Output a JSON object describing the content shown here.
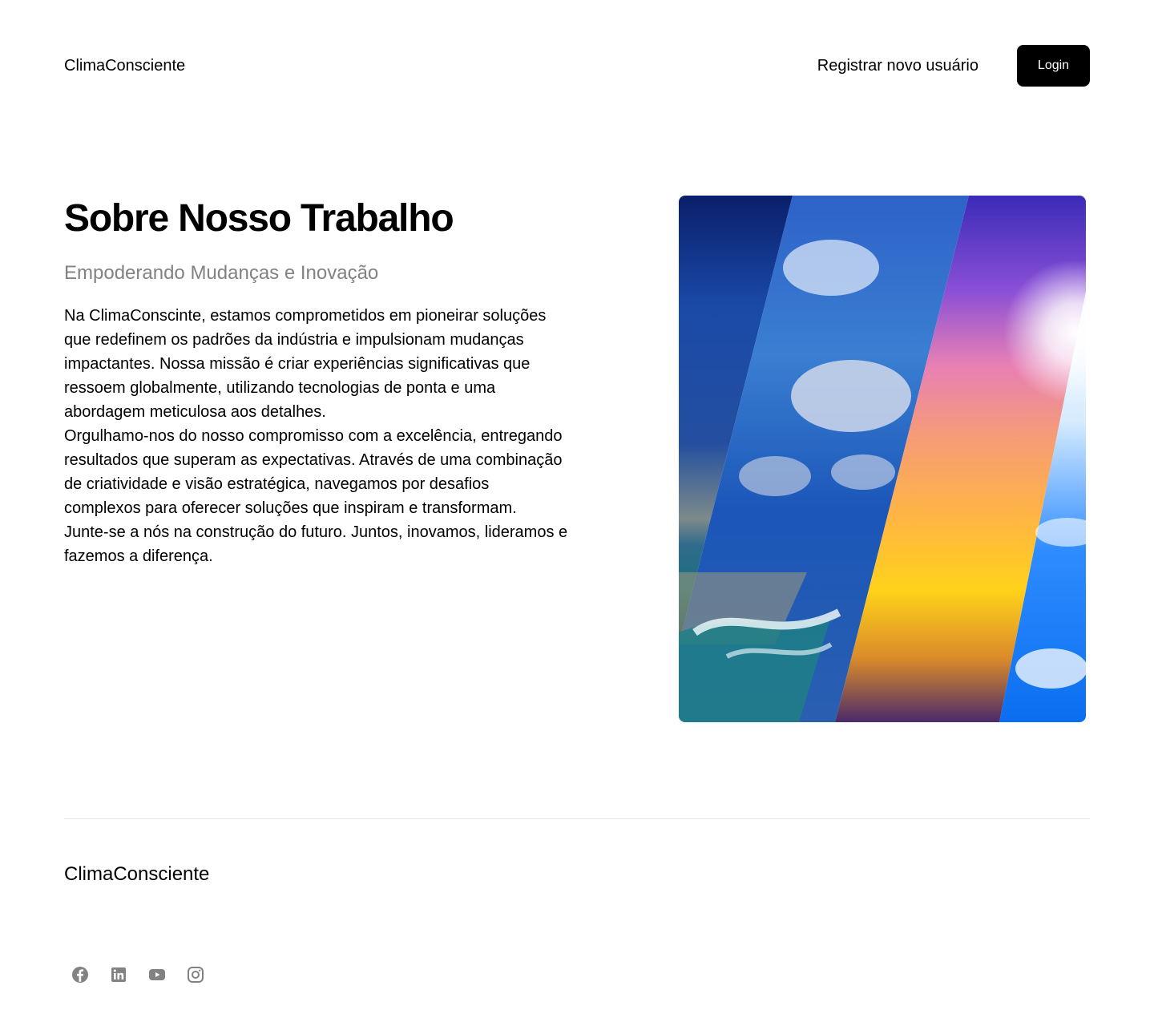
{
  "header": {
    "brand": "ClimaConsciente",
    "register_label": "Registrar novo usuário",
    "login_label": "Login"
  },
  "hero": {
    "title": "Sobre Nosso Trabalho",
    "subtitle": "Empoderando Mudanças e Inovação",
    "paragraphs": [
      "Na ClimaConscinte, estamos comprometidos em pioneirar soluções que redefinem os padrões da indústria e impulsionam mudanças impactantes. Nossa missão é criar experiências significativas que ressoem globalmente, utilizando tecnologias de ponta e uma abordagem meticulosa aos detalhes.",
      "Orgulhamo-nos do nosso compromisso com a excelência, entregando resultados que superam as expectativas. Através de uma combinação de criatividade e visão estratégica, navegamos por desafios complexos para oferecer soluções que inspiram e transformam.",
      "Junte-se a nós na construção do futuro. Juntos, inovamos, lideramos e fazemos a diferença."
    ]
  },
  "footer": {
    "brand": "ClimaConsciente",
    "social_icons": [
      "facebook-icon",
      "linkedin-icon",
      "youtube-icon",
      "instagram-icon"
    ],
    "icon_color": "#828282"
  },
  "colors": {
    "accent": "#000000",
    "muted_text": "#828282",
    "divider": "#e6e6e6"
  }
}
